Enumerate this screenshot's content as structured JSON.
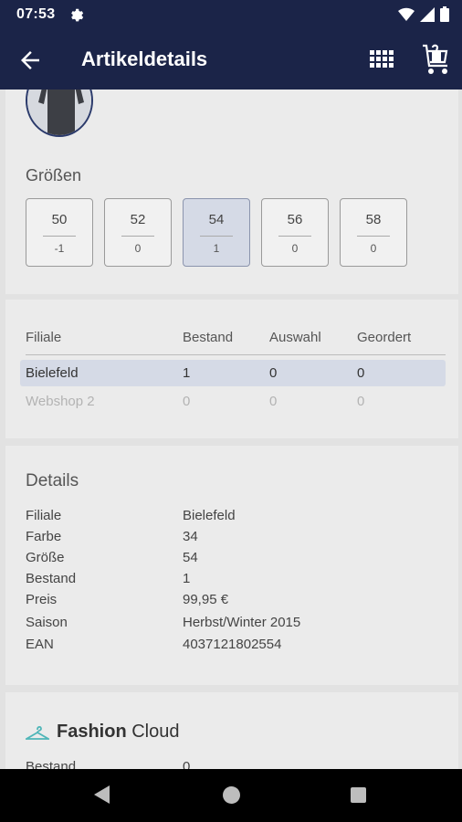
{
  "status": {
    "time": "07:53",
    "icons": [
      "gear-icon",
      "wifi-icon",
      "signal-icon",
      "battery-icon"
    ]
  },
  "appbar": {
    "title": "Artikeldetails",
    "icons": [
      "back-arrow-icon",
      "grid-icon",
      "cart-icon"
    ]
  },
  "sizes": {
    "title": "Größen",
    "items": [
      {
        "size": "50",
        "count": "-1",
        "selected": false
      },
      {
        "size": "52",
        "count": "0",
        "selected": false
      },
      {
        "size": "54",
        "count": "1",
        "selected": true
      },
      {
        "size": "56",
        "count": "0",
        "selected": false
      },
      {
        "size": "58",
        "count": "0",
        "selected": false
      }
    ]
  },
  "branches": {
    "headers": [
      "Filiale",
      "Bestand",
      "Auswahl",
      "Geordert"
    ],
    "rows": [
      {
        "filiale": "Bielefeld",
        "bestand": "1",
        "auswahl": "0",
        "geordert": "0",
        "selected": true
      },
      {
        "filiale": "Webshop 2",
        "bestand": "0",
        "auswahl": "0",
        "geordert": "0",
        "selected": false
      }
    ]
  },
  "details": {
    "title": "Details",
    "rows": [
      {
        "label": "Filiale",
        "value": "Bielefeld"
      },
      {
        "label": "Farbe",
        "value": "34"
      },
      {
        "label": "Größe",
        "value": "54"
      },
      {
        "label": "Bestand",
        "value": "1"
      },
      {
        "label": "Preis",
        "value": "99,95 €"
      },
      {
        "label": "Saison",
        "value": "Herbst/Winter 2015"
      },
      {
        "label": "EAN",
        "value": "4037121802554"
      }
    ]
  },
  "fashion_cloud": {
    "brand_bold": "Fashion",
    "brand_light": "Cloud",
    "row": {
      "label": "Bestand",
      "value": "0"
    },
    "accent": "#4fb6b8"
  },
  "colors": {
    "primary": "#1b2448",
    "selected": "#d5dae6"
  }
}
